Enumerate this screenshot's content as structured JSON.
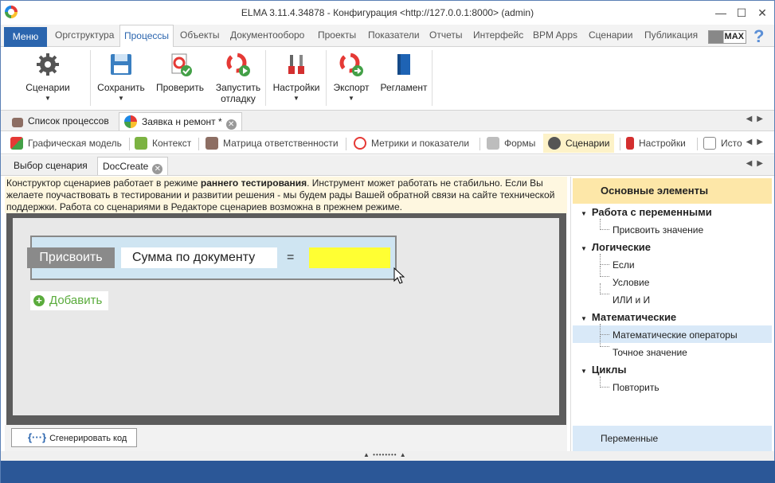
{
  "window": {
    "title": "ELMA 3.11.4.34878 - Конфигурация <http://127.0.0.1:8000> (admin)",
    "controls": [
      "—",
      "☐",
      "✕"
    ]
  },
  "menubar": {
    "menu_label": "Меню",
    "tabs": [
      "Оргструктура",
      "Процессы",
      "Объекты",
      "Документооборо",
      "Проекты",
      "Показатели",
      "Отчеты",
      "Интерфейс",
      "BPM Apps",
      "Сценарии",
      "Публикация"
    ],
    "active_tab": "Процессы",
    "max_label": "MAX",
    "help": "?"
  },
  "ribbon": {
    "buttons": [
      {
        "label": "Сценарии",
        "icon": "gear-icon",
        "has_dropdown": true
      },
      {
        "label": "Сохранить",
        "icon": "save-icon",
        "has_dropdown": true
      },
      {
        "label": "Проверить",
        "icon": "check-icon",
        "has_dropdown": false
      },
      {
        "label": "Запустить",
        "label2": "отладку",
        "icon": "run-debug-icon",
        "has_dropdown": false
      },
      {
        "label": "Настройки",
        "icon": "tools-icon",
        "has_dropdown": true
      },
      {
        "label": "Экспорт",
        "icon": "export-icon",
        "has_dropdown": true
      },
      {
        "label": "Регламент",
        "icon": "book-icon",
        "has_dropdown": false
      }
    ]
  },
  "doc_tabs": {
    "tabs": [
      {
        "label": "Список процессов"
      },
      {
        "label": "Заявка н ремонт *"
      }
    ]
  },
  "sub_tabs": {
    "items": [
      "Графическая модель",
      "Контекст",
      "Матрица ответственности",
      "Метрики и показатели",
      "Формы",
      "Сценарии",
      "Настройки",
      "Исто"
    ],
    "active": "Сценарии"
  },
  "scenario_tabs": {
    "tabs": [
      "Выбор сценария",
      "DocCreate"
    ],
    "active": "DocCreate"
  },
  "warning": {
    "part1": "Конструктор сценариев работает в режиме ",
    "bold": "раннего тестирования",
    "part2": ". Инструмент может работать не стабильно. Если Вы желаете поучаствовать в тестировании и развитии решения - мы будем рады Вашей обратной связи на сайте технической поддержки. Работа со сценариями в Редакторе сценариев возможна в прежнем режиме."
  },
  "canvas": {
    "assign_label": "Присвоить",
    "variable": "Сумма по документу",
    "operator": "=",
    "value": "",
    "value_color": "#ffff33",
    "add_label": "Добавить"
  },
  "generate_button": "Сгенерировать код",
  "sidebar": {
    "header": "Основные элементы",
    "groups": [
      {
        "label": "Работа с переменными",
        "items": [
          "Присвоить значение"
        ]
      },
      {
        "label": "Логические",
        "items": [
          "Если",
          "Условие",
          "ИЛИ и И"
        ]
      },
      {
        "label": "Математические",
        "items": [
          "Математические операторы",
          "Точное значение"
        ]
      },
      {
        "label": "Циклы",
        "items": [
          "Повторить"
        ]
      }
    ],
    "highlighted": "Математические операторы",
    "footer": "Переменные"
  },
  "colors": {
    "accent": "#2b65ae",
    "active_subtab": "#fdf2c8",
    "sidebar_header": "#fde7a8",
    "selection": "#d9e9f8",
    "add_green": "#5aab3c"
  }
}
